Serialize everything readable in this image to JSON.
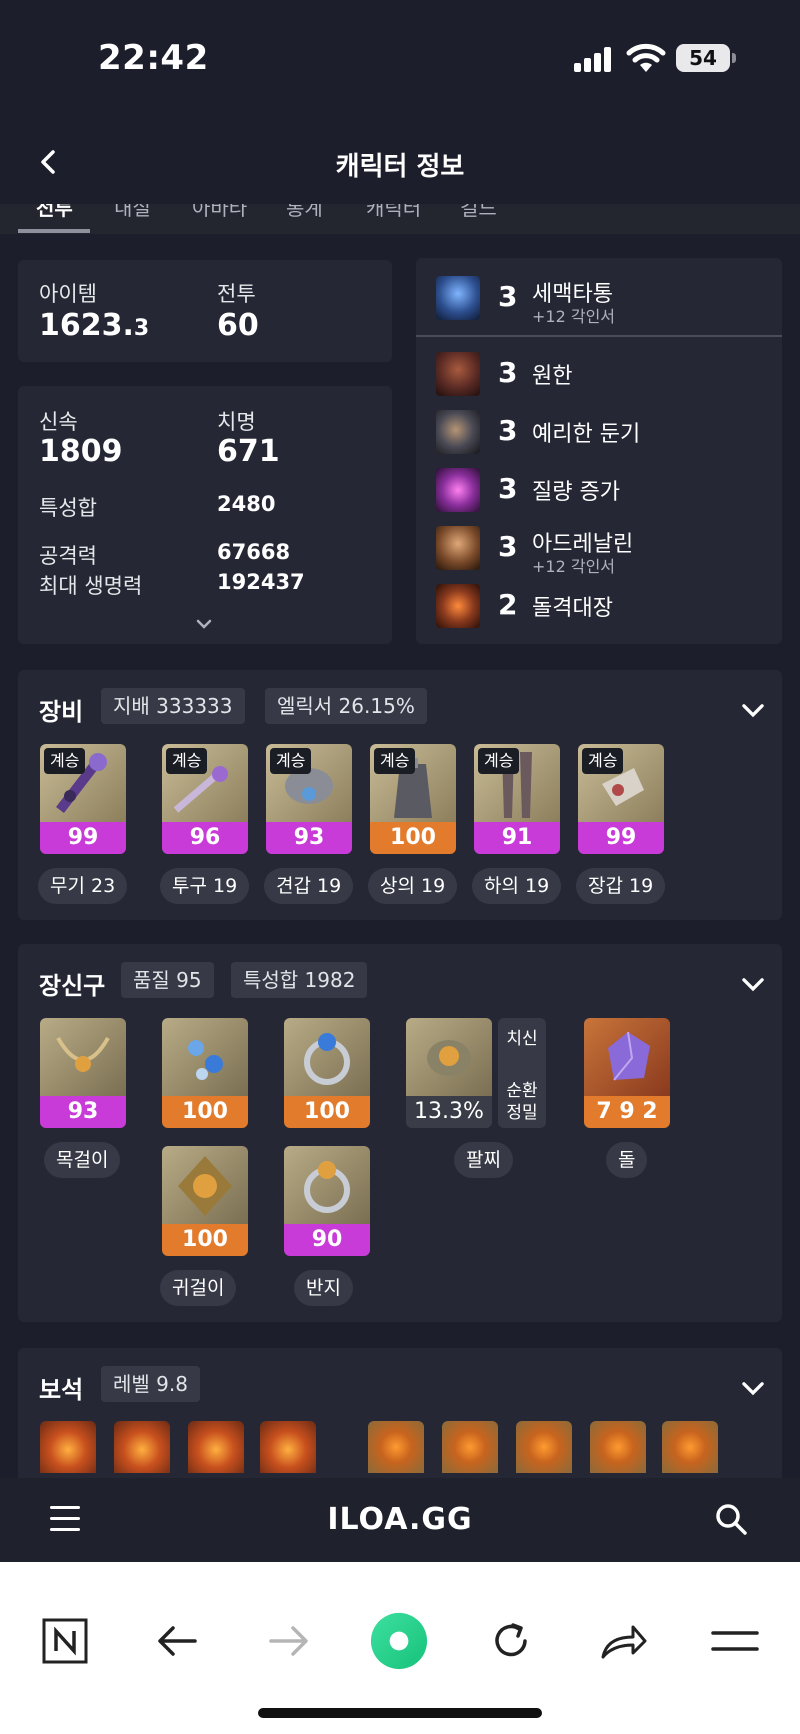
{
  "status": {
    "time": "22:42",
    "battery": "54"
  },
  "header": {
    "title": "캐릭터 정보"
  },
  "tabs": [
    "전투",
    "내실",
    "아바타",
    "통계",
    "캐릭터",
    "길드"
  ],
  "summary": {
    "item_label": "아이템",
    "item_value": "1623.",
    "item_decimal": "3",
    "combat_label": "전투",
    "combat_value": "60"
  },
  "stats": {
    "speed_label": "신속",
    "speed_value": "1809",
    "crit_label": "치명",
    "crit_value": "671",
    "total_label": "특성합",
    "total_value": "2480",
    "atk_label": "공격력",
    "atk_value": "67668",
    "hp_label": "최대 생명력",
    "hp_value": "192437"
  },
  "engravings": [
    {
      "level": "3",
      "name": "세맥타통",
      "sub": "+12 각인서",
      "icon_color": "#2d4f8f"
    },
    {
      "level": "3",
      "name": "원한",
      "sub": "",
      "icon_color": "#5a2a24"
    },
    {
      "level": "3",
      "name": "예리한 둔기",
      "sub": "",
      "icon_color": "#4a4a55"
    },
    {
      "level": "3",
      "name": "질량 증가",
      "sub": "",
      "icon_color": "#8a2f9c"
    },
    {
      "level": "3",
      "name": "아드레날린",
      "sub": "+12 각인서",
      "icon_color": "#7a4a2a"
    },
    {
      "level": "2",
      "name": "돌격대장",
      "sub": "",
      "icon_color": "#8a3a1e"
    }
  ],
  "equipment": {
    "title": "장비",
    "chip1": "지배 333333",
    "chip2": "엘릭서 26.15%",
    "inherit_label": "계승",
    "items": [
      {
        "quality": "99",
        "label": "무기 23",
        "bar": "purple"
      },
      {
        "quality": "96",
        "label": "투구 19",
        "bar": "purple"
      },
      {
        "quality": "93",
        "label": "견갑 19",
        "bar": "purple"
      },
      {
        "quality": "100",
        "label": "상의 19",
        "bar": "orange"
      },
      {
        "quality": "91",
        "label": "하의 19",
        "bar": "purple"
      },
      {
        "quality": "99",
        "label": "장갑 19",
        "bar": "purple"
      }
    ]
  },
  "accessories": {
    "title": "장신구",
    "chip1": "품질 95",
    "chip2": "특성합 1982",
    "necklace": {
      "quality": "93",
      "label": "목걸이"
    },
    "earring1": {
      "quality": "100"
    },
    "ring1": {
      "quality": "100"
    },
    "earring2": {
      "quality": "100",
      "label": "귀걸이"
    },
    "ring2": {
      "quality": "90",
      "label": "반지"
    },
    "bracelet": {
      "value": "13.3%",
      "label": "팔찌",
      "tag1": "치신",
      "tag2": "순환",
      "tag3": "정밀"
    },
    "stone": {
      "value": "7 9 2",
      "label": "돌"
    }
  },
  "gems": {
    "title": "보석",
    "chip": "레벨 9.8"
  },
  "bottom": {
    "logo": "ILOA.GG"
  }
}
